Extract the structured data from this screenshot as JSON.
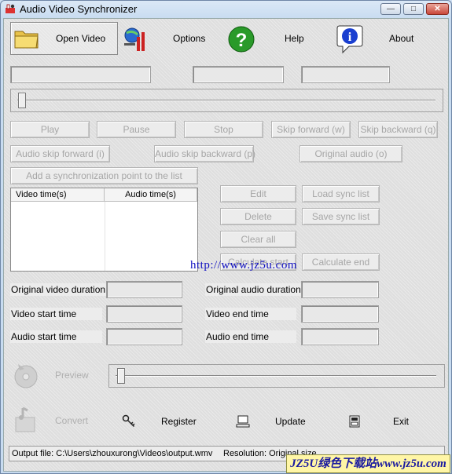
{
  "window": {
    "title": "Audio Video Synchronizer"
  },
  "toolbar": {
    "open_video": "Open Video",
    "options": "Options",
    "help": "Help",
    "about": "About"
  },
  "controls": {
    "play": "Play",
    "pause": "Pause",
    "stop": "Stop",
    "skip_forward": "Skip forward (w)",
    "skip_backward": "Skip backward (q)",
    "audio_skip_forward": "Audio skip forward (i)",
    "audio_skip_backward": "Audio skip backward (p)",
    "original_audio": "Original audio (o)",
    "add_sync_point": "Add a synchronization point to the list"
  },
  "sync_list": {
    "columns": [
      "Video time(s)",
      "Audio time(s)"
    ],
    "rows": []
  },
  "list_actions": {
    "edit": "Edit",
    "load": "Load sync list",
    "delete": "Delete",
    "save": "Save sync list",
    "clear": "Clear all",
    "calc_start": "Calculate start",
    "calc_end": "Calculate end"
  },
  "info": {
    "orig_video_duration": "Original video duration",
    "orig_audio_duration": "Original audio duration",
    "video_start": "Video start time",
    "video_end": "Video end time",
    "audio_start": "Audio start time",
    "audio_end": "Audio end time"
  },
  "bottom": {
    "preview": "Preview",
    "convert": "Convert",
    "register": "Register",
    "update": "Update",
    "exit": "Exit"
  },
  "status": {
    "output": "Output file: C:\\Users\\zhouxurong\\Videos\\output.wmv",
    "resolution": "Resolution: Original size"
  },
  "watermark": {
    "url": "http://www.jz5u.com",
    "badge": "JZ5U绿色下载站www.jz5u.com"
  }
}
